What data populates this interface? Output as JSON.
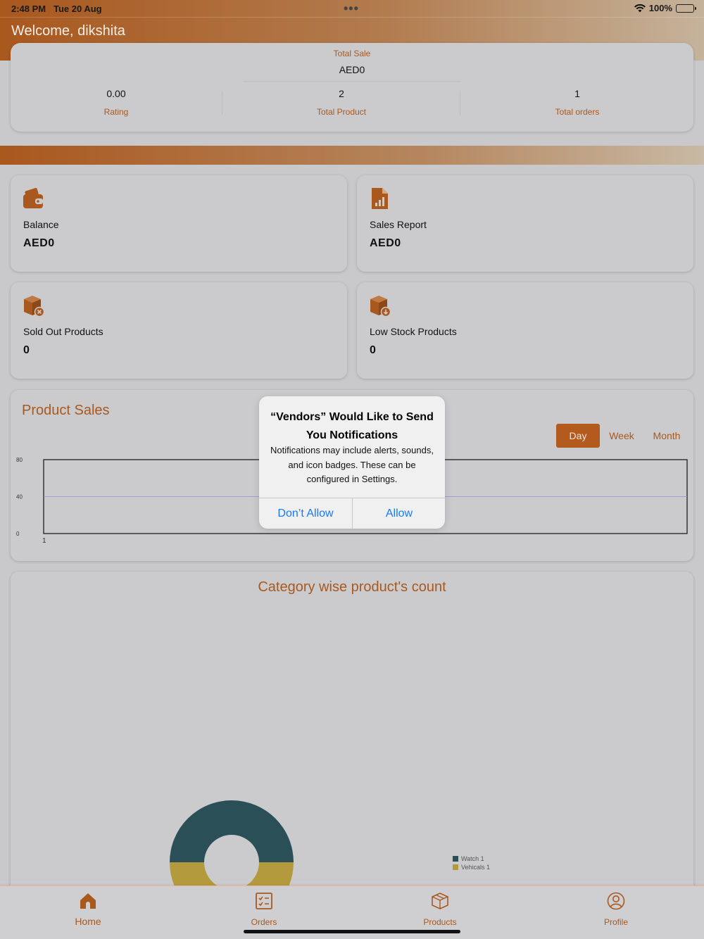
{
  "status_bar": {
    "time": "2:48 PM",
    "date": "Tue 20 Aug",
    "battery": "100%",
    "battery_level": 1.0,
    "wifi_icon": "wifi-icon",
    "battery_icon": "battery-icon"
  },
  "header": {
    "welcome": "Welcome, dikshita"
  },
  "summary": {
    "total_sale_label": "Total Sale",
    "total_sale_value": "AED0",
    "rating_value": "0.00",
    "rating_label": "Rating",
    "total_product_value": "2",
    "total_product_label": "Total Product",
    "total_orders_value": "1",
    "total_orders_label": "Total orders"
  },
  "tiles": {
    "balance": {
      "label": "Balance",
      "value": "AED0",
      "icon": "wallet-icon"
    },
    "sales_report": {
      "label": "Sales Report",
      "value": "AED0",
      "icon": "report-icon"
    },
    "sold_out": {
      "label": "Sold Out Products",
      "value": "0",
      "icon": "box-x-icon"
    },
    "low_stock": {
      "label": "Low Stock Products",
      "value": "0",
      "icon": "box-down-icon"
    }
  },
  "product_sales": {
    "title": "Product Sales",
    "periods": [
      "Day",
      "Week",
      "Month"
    ],
    "active_period": "Day"
  },
  "category": {
    "title": "Category wise product's count"
  },
  "tabbar": {
    "home": "Home",
    "orders": "Orders",
    "products": "Products",
    "profile": "Profile"
  },
  "alert": {
    "title": "“Vendors” Would Like to Send You Notifications",
    "message": "Notifications may include alerts, sounds, and icon badges. These can be configured in Settings.",
    "deny": "Don’t Allow",
    "allow": "Allow"
  },
  "colors": {
    "accent": "#a9581e",
    "alert_button": "#1479ff",
    "donut_watch": "#2b4f57",
    "donut_vehicals": "#b39a3d"
  },
  "chart_data": [
    {
      "type": "line",
      "x": [
        "1"
      ],
      "yticks": [
        "80",
        "40",
        "0"
      ],
      "ylim": [
        0,
        80
      ],
      "series": [],
      "grid": true
    },
    {
      "type": "pie",
      "categories": [
        "Watch 1",
        "Vehicals 1"
      ],
      "values": [
        1,
        1
      ],
      "legend": "right",
      "colors": [
        "#2b4f57",
        "#b39a3d"
      ]
    }
  ]
}
